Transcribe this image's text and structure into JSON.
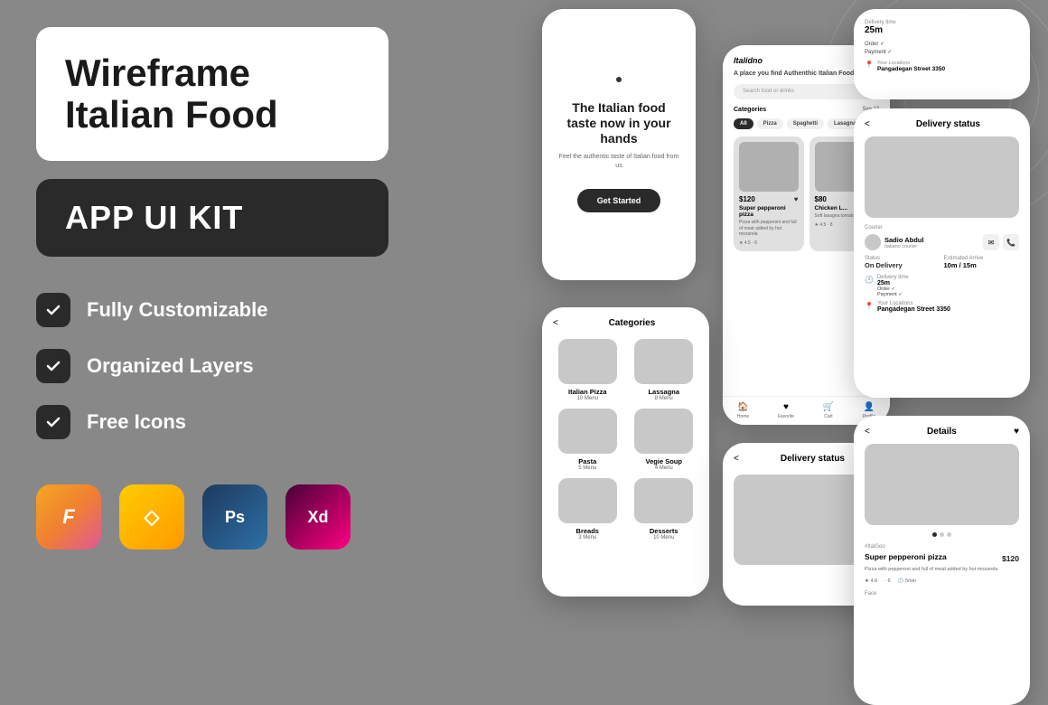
{
  "page": {
    "background": "#888888",
    "title": "Wireframe Italian Food APP UI KIT"
  },
  "left_panel": {
    "title_line1": "Wireframe Italian Food",
    "subtitle": "APP UI KIT",
    "features": [
      {
        "label": "Fully Customizable"
      },
      {
        "label": "Organized Layers"
      },
      {
        "label": "Free Icons"
      }
    ],
    "tools": [
      {
        "name": "Figma",
        "symbol": "F"
      },
      {
        "name": "Sketch",
        "symbol": "S"
      },
      {
        "name": "Photoshop",
        "symbol": "Ps"
      },
      {
        "name": "Adobe XD",
        "symbol": "Xd"
      }
    ]
  },
  "splash_screen": {
    "dot": "•",
    "title": "The Italian food taste now in your hands",
    "subtitle": "Feel the authentic taste of Italian food from us",
    "cta_button": "Get Started"
  },
  "home_screen": {
    "logo": "Italidno",
    "tagline_pre": "A place you find ",
    "tagline_bold": "Authenthic Italian Food",
    "search_placeholder": "Search food or drinks",
    "categories_label": "Categories",
    "see_all": "See All",
    "category_pills": [
      "All",
      "Pizza",
      "Spaghetti",
      "Lasagna"
    ],
    "food_items": [
      {
        "price": "$120",
        "name": "Super pepperoni pizza",
        "desc": "Pizza with pepperoni and full of meat added by hot mozarela",
        "rating": "4.5",
        "reviews": "6"
      },
      {
        "price": "$80",
        "name": "Chicken L...",
        "desc": "Soft lasagna tomato sauc...",
        "rating": "4.5",
        "reviews": "8"
      }
    ],
    "nav_items": [
      "Home",
      "Favorite",
      "Cart",
      "Profile"
    ]
  },
  "categories_screen": {
    "back": "<",
    "title": "Categories",
    "items": [
      {
        "name": "Italian Pizza",
        "count": "10 Menu"
      },
      {
        "name": "Lassagna",
        "count": "8 Menu"
      },
      {
        "name": "Pasta",
        "count": "5 Menu"
      },
      {
        "name": "Vegie Soup",
        "count": "4 Menu"
      },
      {
        "name": "Breads",
        "count": "3 Menu"
      },
      {
        "name": "Desserts",
        "count": "10 Menu"
      }
    ]
  },
  "delivery_status_screen": {
    "back": "<",
    "title": "Delivery status",
    "courier_label": "Courier",
    "courier_name": "Sadio Abdul",
    "courier_role": "Italiano courier",
    "status_label": "Status",
    "status_value": "On Delivery",
    "estimated_arrive_label": "Estimated Arrive",
    "estimated_arrive": "10m / 15m",
    "delivery_time_label": "Delivery time",
    "delivery_time": "25m",
    "order_label": "Order",
    "order_status": "✓",
    "payment_label": "Payment",
    "payment_status": "✓",
    "location_label": "Your Locations",
    "location_value": "Pangadegan Street 3350"
  },
  "details_screen": {
    "back": "<",
    "title": "Details",
    "product_name": "Super pepperoni pizza",
    "price": "$120",
    "desc": "Pizza with pepperoni and full of meat added by hot mozarela",
    "rating": "4.8",
    "reviews": "6",
    "time": "5min",
    "category_label": "#ItalGoo",
    "face_label": "Face"
  },
  "info_card": {
    "delivery_time_label": "Delivery time",
    "delivery_time": "25m",
    "order_label": "Order",
    "order_check": "✓",
    "payment_label": "Payment",
    "payment_check": "✓",
    "location_label": "Your Locations",
    "location": "Pangadegan Street 3350"
  }
}
